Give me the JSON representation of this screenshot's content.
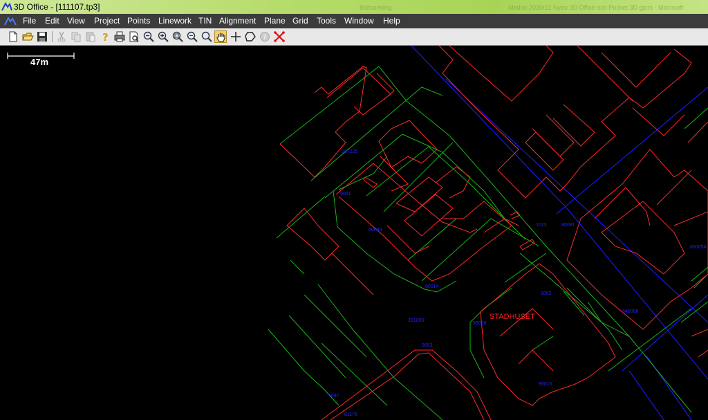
{
  "window": {
    "title": "3D Office - [111107.tp3]",
    "faint_left": "Bildsamling",
    "faint_right": "Meddo 2020/22 Nyeo 3D Office och Pocket 3D gjors - Microsoft"
  },
  "menu": {
    "items": [
      "File",
      "Edit",
      "View",
      "Project",
      "Points",
      "Linework",
      "TIN",
      "Alignment",
      "Plane",
      "Grid",
      "Tools",
      "Window",
      "Help"
    ]
  },
  "toolbar": {
    "tools": [
      {
        "name": "new-file-icon",
        "enabled": true
      },
      {
        "name": "open-folder-icon",
        "enabled": true
      },
      {
        "name": "save-icon",
        "enabled": true
      },
      {
        "name": "cut-icon",
        "enabled": false
      },
      {
        "name": "copy-icon",
        "enabled": false
      },
      {
        "name": "paste-icon",
        "enabled": false
      },
      {
        "name": "help-pointer-icon",
        "enabled": true
      },
      {
        "name": "print-icon",
        "enabled": true
      },
      {
        "name": "print-preview-icon",
        "enabled": true
      },
      {
        "name": "zoom-out-icon",
        "enabled": true
      },
      {
        "name": "zoom-in-icon",
        "enabled": true
      },
      {
        "name": "zoom-window-icon",
        "enabled": true
      },
      {
        "name": "zoom-previous-icon",
        "enabled": true
      },
      {
        "name": "zoom-extents-icon",
        "enabled": true
      },
      {
        "name": "pan-hand-icon",
        "enabled": true,
        "active": true
      },
      {
        "name": "crosshair-icon",
        "enabled": true
      },
      {
        "name": "polygon-icon",
        "enabled": true
      },
      {
        "name": "info-icon",
        "enabled": false
      },
      {
        "name": "delete-points-icon",
        "enabled": true
      }
    ]
  },
  "map": {
    "scale_label": "47m",
    "place_name": "STADHUSET",
    "point_labels": [
      "107225",
      "9001",
      "60088",
      "90014",
      "201005",
      "1083",
      "90088",
      "9003",
      "90016",
      "2013",
      "80081",
      "846086",
      "800054",
      "9097",
      "81176",
      "80019"
    ],
    "colors": {
      "buildings": "#ff2a2a",
      "property": "#19b419",
      "road": "#1a1aff",
      "labels": "#2222ff"
    }
  }
}
